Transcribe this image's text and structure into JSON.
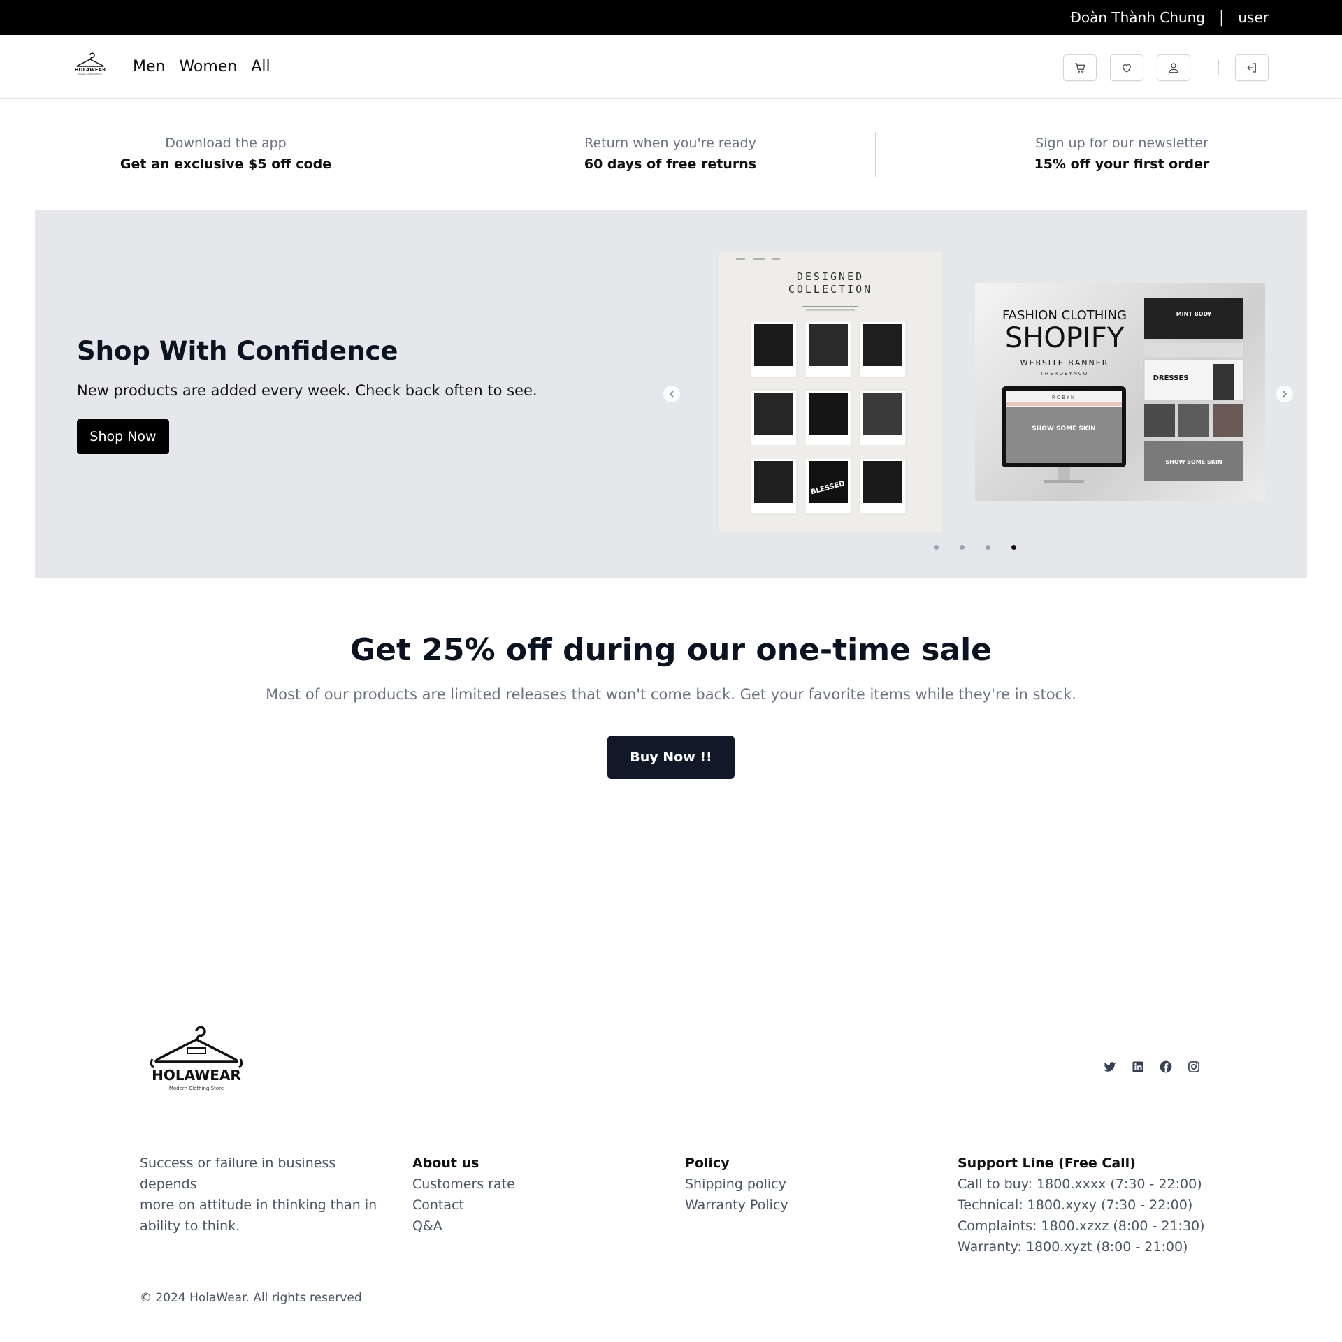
{
  "topbar": {
    "user_name": "Đoàn Thành Chung",
    "separator": "|",
    "role": "user"
  },
  "header": {
    "nav": [
      "Men",
      "Women",
      "All"
    ],
    "icons": [
      "cart-icon",
      "heart-icon",
      "user-icon",
      "logout-icon"
    ],
    "divider": "|"
  },
  "perks": [
    {
      "sub": "Download the app",
      "main": "Get an exclusive $5 off code"
    },
    {
      "sub": "Return when you're ready",
      "main": "60 days of free returns"
    },
    {
      "sub": "Sign up for our newsletter",
      "main": "15% off your first order"
    }
  ],
  "hero": {
    "title": "Shop With Confidence",
    "subtitle": "New products are added every week. Check back often to see.",
    "button": "Shop Now",
    "slide1": {
      "title_line1": "DESIGNED",
      "title_line2": "COLLECTION",
      "labels": [
        "BLESSED"
      ]
    },
    "slide2": {
      "line1": "FASHION CLOTHING",
      "line2": "SHOPIFY",
      "line3": "WEBSITE BANNER",
      "line4": "THEROBYNCO",
      "brand": "ROBYN",
      "cta": "SHOW SOME SKIN",
      "tile1": "MINT BODY",
      "tile2": "DRESSES"
    },
    "slides_total": 4,
    "active_slide": 4
  },
  "sale": {
    "title": "Get 25% off during our one-time sale",
    "subtitle": "Most of our products are limited releases that won't come back. Get your favorite items while they're in stock.",
    "button": "Buy Now !!"
  },
  "footer": {
    "logo_text": "HOLAWEAR",
    "logo_tagline": "Modern Clothing Store",
    "tagline": [
      "Success or failure in business depends",
      "more on attitude in thinking than in",
      "ability to think."
    ],
    "about": {
      "title": "About us",
      "links": [
        "Customers rate",
        "Contact",
        "Q&A"
      ]
    },
    "policy": {
      "title": "Policy",
      "links": [
        "Shipping policy",
        "Warranty Policy"
      ]
    },
    "support": {
      "title": "Support Line (Free Call)",
      "lines": [
        "Call to buy: 1800.xxxx (7:30 - 22:00)",
        "Technical: 1800.xyxy (7:30 - 22:00)",
        "Complaints: 1800.xzxz (8:00 - 21:30)",
        "Warranty: 1800.xyzt (8:00 - 21:00)"
      ]
    },
    "socials": [
      "twitter-icon",
      "linkedin-icon",
      "facebook-icon",
      "instagram-icon"
    ],
    "copyright": "© 2024 HolaWear. All rights reserved"
  }
}
